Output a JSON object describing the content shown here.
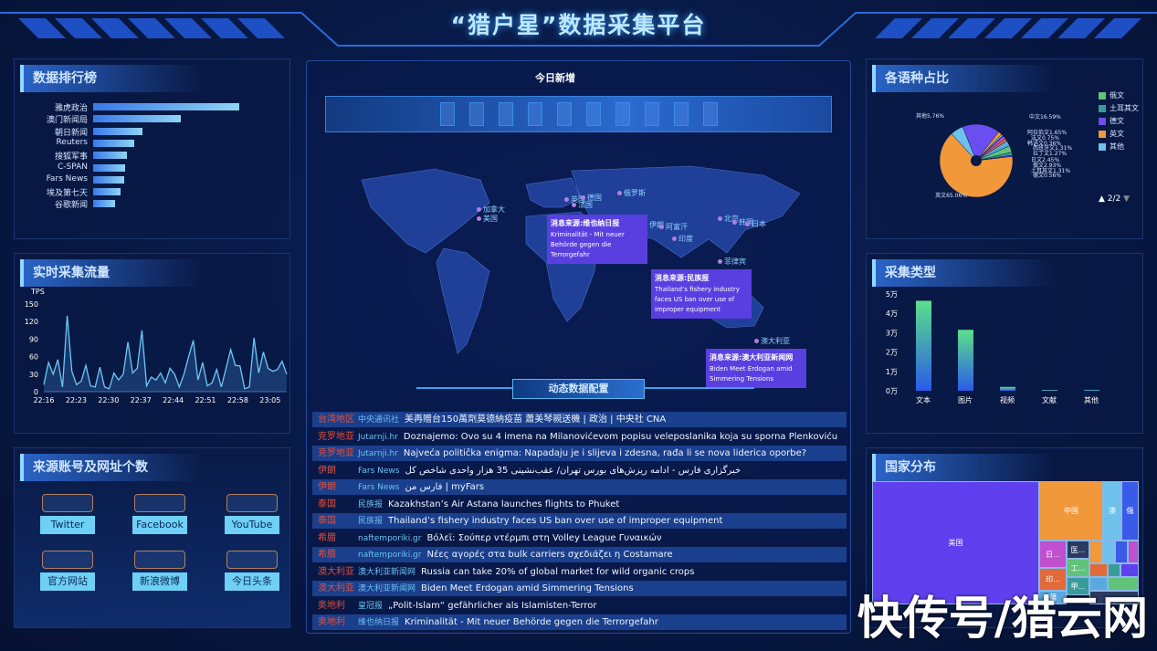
{
  "header": {
    "title": "“猎户星”数据采集平台"
  },
  "ranking": {
    "title": "数据排行榜",
    "items": [
      {
        "label": "雅虎政治",
        "rel": 100
      },
      {
        "label": "澳门新闻局",
        "rel": 60
      },
      {
        "label": "朝日新闻",
        "rel": 34
      },
      {
        "label": "Reuters",
        "rel": 28
      },
      {
        "label": "搜狐军事",
        "rel": 23
      },
      {
        "label": "C-SPAN",
        "rel": 22
      },
      {
        "label": "Fars News",
        "rel": 21
      },
      {
        "label": "埃及第七天",
        "rel": 19
      },
      {
        "label": "谷歌新闻",
        "rel": 15
      }
    ]
  },
  "traffic": {
    "title": "实时采集流量",
    "chart_data": {
      "type": "area",
      "ylabel": "TPS",
      "ylim": [
        0,
        150
      ],
      "yticks": [
        "0",
        "30",
        "60",
        "90",
        "120",
        "150"
      ],
      "xticks": [
        "22:16",
        "22:23",
        "22:30",
        "22:37",
        "22:44",
        "22:51",
        "22:58",
        "23:05"
      ],
      "values": [
        12,
        50,
        30,
        55,
        8,
        130,
        35,
        12,
        18,
        45,
        10,
        8,
        42,
        8,
        5,
        32,
        20,
        30,
        85,
        32,
        40,
        105,
        10,
        25,
        20,
        32,
        15,
        40,
        30,
        8,
        30,
        60,
        88,
        20,
        50,
        10,
        15,
        38,
        8,
        40,
        72,
        45,
        44,
        5,
        8,
        92,
        32,
        68,
        40,
        35,
        38,
        52,
        30
      ]
    }
  },
  "accounts": {
    "title": "来源账号及网址个数",
    "items": [
      "Twitter",
      "Facebook",
      "YouTube",
      "官方网站",
      "新浪微博",
      "今日头条"
    ]
  },
  "center": {
    "today_label": "今日新增",
    "section_title": "动态数据配置",
    "map_labels": [
      "加拿大",
      "美国",
      "英国",
      "德国",
      "法国",
      "俄罗斯",
      "伊朗",
      "阿富汗",
      "印度",
      "北京",
      "韩国",
      "日本",
      "菲律宾",
      "澳大利亚"
    ],
    "popups": [
      {
        "title": "消息来源:维也纳日报",
        "text": "Kriminalität - Mit neuer Behörde gegen die Terrorgefahr"
      },
      {
        "title": "消息来源:民族报",
        "text": "Thailand’s fishery industry faces US ban over use of improper equipment"
      },
      {
        "title": "消息来源:澳大利亚新闻网",
        "text": "Biden Meet Erdogan amid Simmering Tensions"
      }
    ],
    "news": [
      {
        "country": "台湾地区",
        "source": "中央通讯社",
        "title": "美再贈台150萬劑莫德納疫苗 蕭美琴親送機 | 政治 | 中央社 CNA"
      },
      {
        "country": "克罗地亚",
        "source": "Jutarnji.hr",
        "title": "Doznajemo: Ovo su 4 imena na Milanovićevom popisu veleposlanika koja su sporna Plenkoviću"
      },
      {
        "country": "克罗地亚",
        "source": "Jutarnji.hr",
        "title": "Najveća politička enigma: Napadaju je i slijeva i zdesna, rađa li se nova liderica oporbe?"
      },
      {
        "country": "伊朗",
        "source": "Fars News",
        "title": "خبرگزاری فارس - ادامه ریزش‌های بورس تهران/ عقب‌نشینی 35 هزار واحدی شاخص کل"
      },
      {
        "country": "伊朗",
        "source": "Fars News",
        "title": "فارس من | myFars"
      },
      {
        "country": "泰国",
        "source": "民族报",
        "title": "Kazakhstan’s Air Astana launches flights to Phuket"
      },
      {
        "country": "泰国",
        "source": "民族报",
        "title": "Thailand’s fishery industry faces US ban over use of improper equipment"
      },
      {
        "country": "希腊",
        "source": "naftemporiki.gr",
        "title": "Βόλεϊ: Σούπερ ντέρμπι στη Volley League Γυναικών"
      },
      {
        "country": "希腊",
        "source": "naftemporiki.gr",
        "title": "Νέες αγορές στα bulk carriers σχεδιάζει η Costamare"
      },
      {
        "country": "澳大利亚",
        "source": "澳大利亚新闻网",
        "title": "Russia can take 20% of global market for wild organic crops"
      },
      {
        "country": "澳大利亚",
        "source": "澳大利亚新闻网",
        "title": "Biden Meet Erdogan amid Simmering Tensions"
      },
      {
        "country": "奥地利",
        "source": "皇冠报",
        "title": "„Polit-Islam“ gefährlicher als Islamisten-Terror"
      },
      {
        "country": "奥地利",
        "source": "维也纳日报",
        "title": "Kriminalität - Mit neuer Behörde gegen die Terrorgefahr"
      }
    ]
  },
  "languages": {
    "title": "各语种占比",
    "page": "2/2",
    "legend": [
      {
        "name": "俄文",
        "color": "#5fc47a"
      },
      {
        "name": "土耳其文",
        "color": "#3a9c9a"
      },
      {
        "name": "德文",
        "color": "#6a4ef0"
      },
      {
        "name": "英文",
        "color": "#f0983a"
      },
      {
        "name": "其他",
        "color": "#6fc1ec"
      }
    ],
    "chart_data": {
      "type": "pie",
      "slices": [
        {
          "name": "中文",
          "value": 16.59,
          "color": "#6a4ef0"
        },
        {
          "name": "阿拉伯文",
          "value": 1.65,
          "color": "#f0983a"
        },
        {
          "name": "法文",
          "value": 0.75,
          "color": "#6fc1ec"
        },
        {
          "name": "韩语文",
          "value": 0.36,
          "color": "#3a5ae0"
        },
        {
          "name": "西班牙文",
          "value": 1.31,
          "color": "#d050c0"
        },
        {
          "name": "拉丁文",
          "value": 1.27,
          "color": "#e06a3a"
        },
        {
          "name": "日文",
          "value": 2.45,
          "color": "#5aa8e0"
        },
        {
          "name": "俄文",
          "value": 2.93,
          "color": "#5fc47a"
        },
        {
          "name": "土耳其文",
          "value": 1.31,
          "color": "#3a9c9a"
        },
        {
          "name": "德文",
          "value": 0.56,
          "color": "#6a4ef0"
        },
        {
          "name": "英文",
          "value": 65.06,
          "color": "#f0983a"
        },
        {
          "name": "其他",
          "value": 5.76,
          "color": "#6fc1ec"
        }
      ]
    }
  },
  "types": {
    "title": "采集类型",
    "chart_data": {
      "type": "bar",
      "categories": [
        "文本",
        "图片",
        "视频",
        "文献",
        "其他"
      ],
      "values": [
        4.65,
        3.15,
        0.2,
        0,
        0.05
      ],
      "yticks": [
        "0万",
        "1万",
        "2万",
        "3万",
        "4万",
        "5万"
      ],
      "ylim": [
        0,
        5
      ]
    }
  },
  "countries": {
    "title": "国家分布",
    "cells": [
      "美国",
      "中国",
      "澳",
      "俄",
      "日...",
      "医...",
      "工...",
      "印...",
      "甲...",
      "蒲"
    ]
  },
  "watermark": "快传号/猎云网"
}
